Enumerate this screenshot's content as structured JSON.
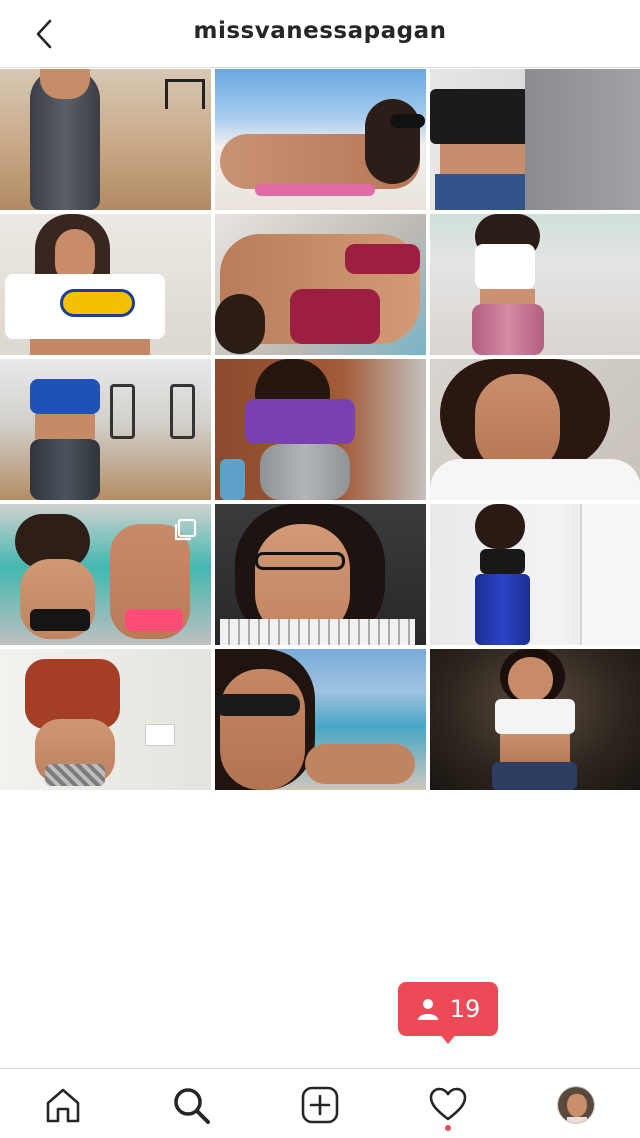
{
  "header": {
    "username": "missvanessapagan"
  },
  "notification": {
    "count": "19",
    "color": "#ed4956"
  },
  "icons": {
    "back": "chevron-left-icon",
    "home": "home-icon",
    "search": "search-icon",
    "new_post": "plus-square-icon",
    "activity": "heart-icon",
    "profile": "profile-avatar",
    "followers": "person-icon",
    "multi": "carousel-icon"
  },
  "grid": {
    "rows": 5,
    "columns": 3
  }
}
